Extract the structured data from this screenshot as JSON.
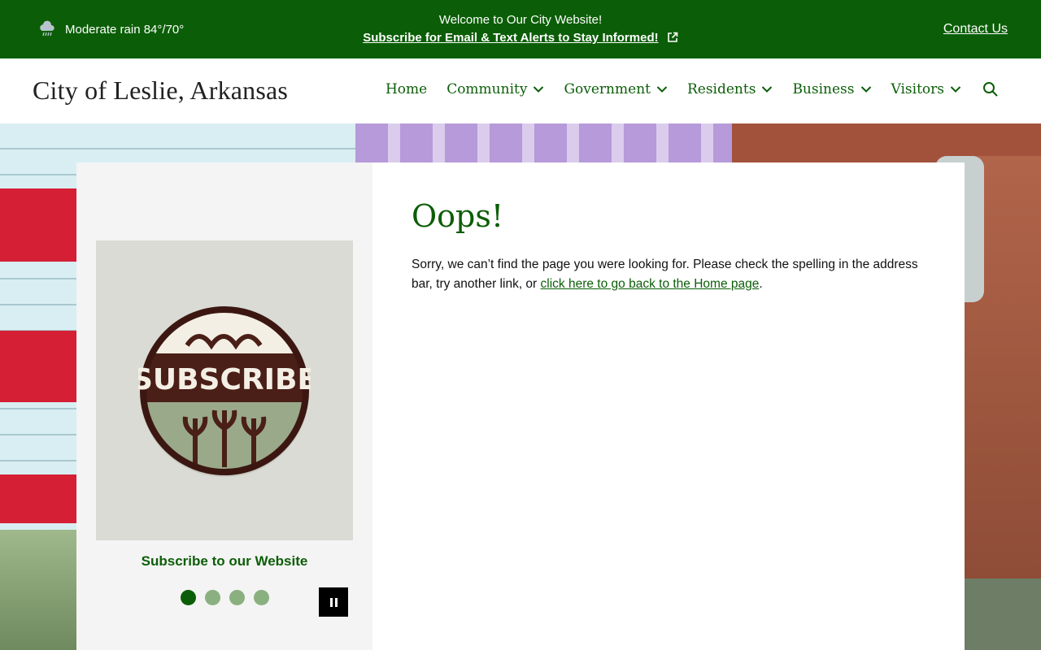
{
  "topbar": {
    "weather": "Moderate rain 84°/70°",
    "weather_icon": "rain-cloud-icon",
    "welcome": "Welcome to Our City Website!",
    "subscribe_link": "Subscribe for Email & Text Alerts to Stay Informed!",
    "contact": "Contact Us",
    "bg_color": "#0b5e07"
  },
  "header": {
    "site_title": "City of Leslie, Arkansas",
    "nav": [
      {
        "label": "Home"
      },
      {
        "label": "Community"
      },
      {
        "label": "Government"
      },
      {
        "label": "Residents"
      },
      {
        "label": "Business"
      },
      {
        "label": "Visitors"
      }
    ],
    "search_icon": "search-icon"
  },
  "sidebar": {
    "slide_image_text": "SUBSCRIBE",
    "caption": "Subscribe to our Website",
    "slides_total": 4,
    "active_slide": 1
  },
  "main": {
    "heading": "Oops!",
    "message_start": "Sorry, we can’t find the page you were looking for. Please check the spelling in the address bar, try another link, or ",
    "home_link": "click here to go back to the Home page",
    "message_end": "."
  },
  "colors": {
    "accent": "#0b5e07",
    "dot_inactive": "#8ab07f"
  }
}
